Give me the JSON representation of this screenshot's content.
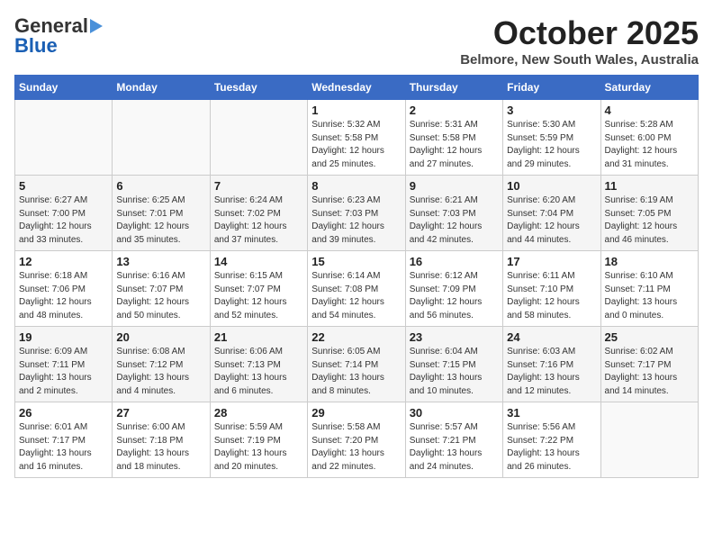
{
  "header": {
    "logo_general": "General",
    "logo_blue": "Blue",
    "month": "October 2025",
    "location": "Belmore, New South Wales, Australia"
  },
  "calendar": {
    "days_of_week": [
      "Sunday",
      "Monday",
      "Tuesday",
      "Wednesday",
      "Thursday",
      "Friday",
      "Saturday"
    ],
    "weeks": [
      [
        {
          "day": "",
          "detail": ""
        },
        {
          "day": "",
          "detail": ""
        },
        {
          "day": "",
          "detail": ""
        },
        {
          "day": "1",
          "detail": "Sunrise: 5:32 AM\nSunset: 5:58 PM\nDaylight: 12 hours\nand 25 minutes."
        },
        {
          "day": "2",
          "detail": "Sunrise: 5:31 AM\nSunset: 5:58 PM\nDaylight: 12 hours\nand 27 minutes."
        },
        {
          "day": "3",
          "detail": "Sunrise: 5:30 AM\nSunset: 5:59 PM\nDaylight: 12 hours\nand 29 minutes."
        },
        {
          "day": "4",
          "detail": "Sunrise: 5:28 AM\nSunset: 6:00 PM\nDaylight: 12 hours\nand 31 minutes."
        }
      ],
      [
        {
          "day": "5",
          "detail": "Sunrise: 6:27 AM\nSunset: 7:00 PM\nDaylight: 12 hours\nand 33 minutes."
        },
        {
          "day": "6",
          "detail": "Sunrise: 6:25 AM\nSunset: 7:01 PM\nDaylight: 12 hours\nand 35 minutes."
        },
        {
          "day": "7",
          "detail": "Sunrise: 6:24 AM\nSunset: 7:02 PM\nDaylight: 12 hours\nand 37 minutes."
        },
        {
          "day": "8",
          "detail": "Sunrise: 6:23 AM\nSunset: 7:03 PM\nDaylight: 12 hours\nand 39 minutes."
        },
        {
          "day": "9",
          "detail": "Sunrise: 6:21 AM\nSunset: 7:03 PM\nDaylight: 12 hours\nand 42 minutes."
        },
        {
          "day": "10",
          "detail": "Sunrise: 6:20 AM\nSunset: 7:04 PM\nDaylight: 12 hours\nand 44 minutes."
        },
        {
          "day": "11",
          "detail": "Sunrise: 6:19 AM\nSunset: 7:05 PM\nDaylight: 12 hours\nand 46 minutes."
        }
      ],
      [
        {
          "day": "12",
          "detail": "Sunrise: 6:18 AM\nSunset: 7:06 PM\nDaylight: 12 hours\nand 48 minutes."
        },
        {
          "day": "13",
          "detail": "Sunrise: 6:16 AM\nSunset: 7:07 PM\nDaylight: 12 hours\nand 50 minutes."
        },
        {
          "day": "14",
          "detail": "Sunrise: 6:15 AM\nSunset: 7:07 PM\nDaylight: 12 hours\nand 52 minutes."
        },
        {
          "day": "15",
          "detail": "Sunrise: 6:14 AM\nSunset: 7:08 PM\nDaylight: 12 hours\nand 54 minutes."
        },
        {
          "day": "16",
          "detail": "Sunrise: 6:12 AM\nSunset: 7:09 PM\nDaylight: 12 hours\nand 56 minutes."
        },
        {
          "day": "17",
          "detail": "Sunrise: 6:11 AM\nSunset: 7:10 PM\nDaylight: 12 hours\nand 58 minutes."
        },
        {
          "day": "18",
          "detail": "Sunrise: 6:10 AM\nSunset: 7:11 PM\nDaylight: 13 hours\nand 0 minutes."
        }
      ],
      [
        {
          "day": "19",
          "detail": "Sunrise: 6:09 AM\nSunset: 7:11 PM\nDaylight: 13 hours\nand 2 minutes."
        },
        {
          "day": "20",
          "detail": "Sunrise: 6:08 AM\nSunset: 7:12 PM\nDaylight: 13 hours\nand 4 minutes."
        },
        {
          "day": "21",
          "detail": "Sunrise: 6:06 AM\nSunset: 7:13 PM\nDaylight: 13 hours\nand 6 minutes."
        },
        {
          "day": "22",
          "detail": "Sunrise: 6:05 AM\nSunset: 7:14 PM\nDaylight: 13 hours\nand 8 minutes."
        },
        {
          "day": "23",
          "detail": "Sunrise: 6:04 AM\nSunset: 7:15 PM\nDaylight: 13 hours\nand 10 minutes."
        },
        {
          "day": "24",
          "detail": "Sunrise: 6:03 AM\nSunset: 7:16 PM\nDaylight: 13 hours\nand 12 minutes."
        },
        {
          "day": "25",
          "detail": "Sunrise: 6:02 AM\nSunset: 7:17 PM\nDaylight: 13 hours\nand 14 minutes."
        }
      ],
      [
        {
          "day": "26",
          "detail": "Sunrise: 6:01 AM\nSunset: 7:17 PM\nDaylight: 13 hours\nand 16 minutes."
        },
        {
          "day": "27",
          "detail": "Sunrise: 6:00 AM\nSunset: 7:18 PM\nDaylight: 13 hours\nand 18 minutes."
        },
        {
          "day": "28",
          "detail": "Sunrise: 5:59 AM\nSunset: 7:19 PM\nDaylight: 13 hours\nand 20 minutes."
        },
        {
          "day": "29",
          "detail": "Sunrise: 5:58 AM\nSunset: 7:20 PM\nDaylight: 13 hours\nand 22 minutes."
        },
        {
          "day": "30",
          "detail": "Sunrise: 5:57 AM\nSunset: 7:21 PM\nDaylight: 13 hours\nand 24 minutes."
        },
        {
          "day": "31",
          "detail": "Sunrise: 5:56 AM\nSunset: 7:22 PM\nDaylight: 13 hours\nand 26 minutes."
        },
        {
          "day": "",
          "detail": ""
        }
      ]
    ]
  }
}
